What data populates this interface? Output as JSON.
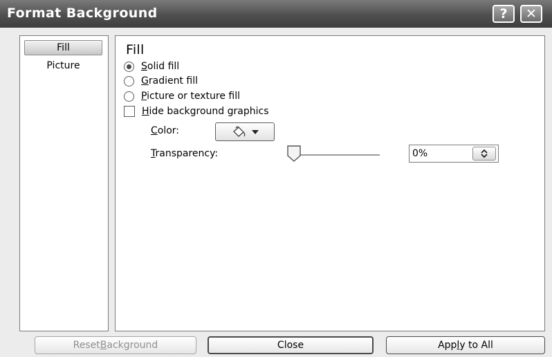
{
  "window": {
    "title": "Format Background",
    "help_label": "?",
    "close_label": "✕"
  },
  "nav": {
    "items": [
      {
        "label": "Fill",
        "selected": true
      },
      {
        "label": "Picture",
        "selected": false
      }
    ]
  },
  "fill": {
    "heading": "Fill",
    "options": {
      "solid": {
        "mnemonic": "S",
        "rest": "olid fill",
        "checked": true
      },
      "gradient": {
        "mnemonic": "G",
        "rest": "radient fill",
        "checked": false
      },
      "picture": {
        "mnemonic": "P",
        "rest": "icture or texture fill",
        "checked": false
      }
    },
    "hide_bg": {
      "mnemonic": "H",
      "rest": "ide background graphics",
      "checked": false
    },
    "color_label": {
      "mnemonic": "C",
      "rest": "olor:"
    },
    "transparency_label": {
      "mnemonic": "T",
      "rest": "ransparency:"
    },
    "transparency_value": "0%",
    "transparency_level": 0
  },
  "buttons": {
    "reset": {
      "pre": "Reset ",
      "mnemonic": "B",
      "rest": "ackground"
    },
    "close": "Close",
    "apply": {
      "pre": "App",
      "mnemonic": "l",
      "rest": "y to All"
    }
  },
  "icons": [
    "paint-bucket-icon",
    "chevron-down-icon",
    "spin-arrows-icon",
    "help-icon",
    "close-icon",
    "slider-thumb-icon"
  ]
}
